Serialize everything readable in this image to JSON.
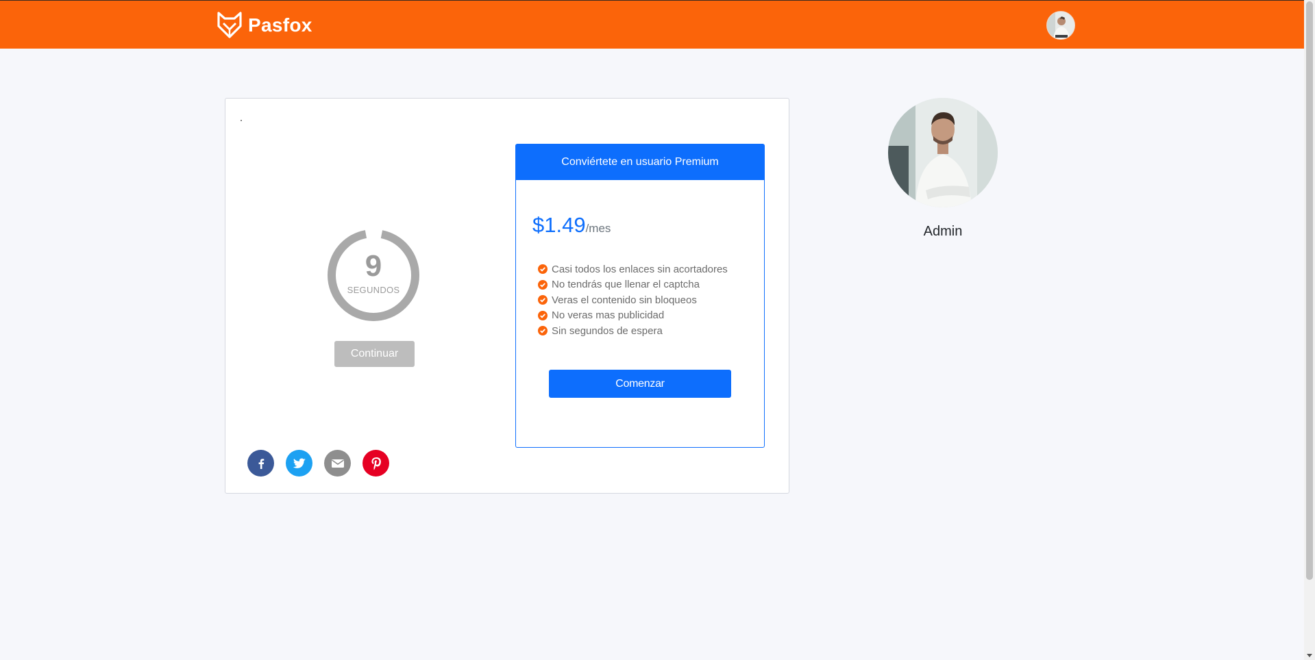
{
  "header": {
    "brand_name": "Pasfox",
    "logo_icon": "fox-icon",
    "background_color": "#fb640a",
    "avatar_icon": "user-avatar"
  },
  "countdown": {
    "seconds": "9",
    "label": "SEGUNDOS",
    "continue_label": "Continuar"
  },
  "premium": {
    "title": "Conviértete en usuario Premium",
    "price": "$1.49",
    "period": "/mes",
    "features": [
      "Casi todos los enlaces sin acortadores",
      "No tendrás que llenar el captcha",
      "Veras el contenido sin bloqueos",
      "No veras mas publicidad",
      "Sin segundos de espera"
    ],
    "cta_label": "Comenzar",
    "accent_color": "#0d6efd",
    "check_color": "#fb640a"
  },
  "share": {
    "icons": [
      "facebook-icon",
      "twitter-icon",
      "email-icon",
      "pinterest-icon"
    ]
  },
  "author": {
    "name": "Admin"
  }
}
